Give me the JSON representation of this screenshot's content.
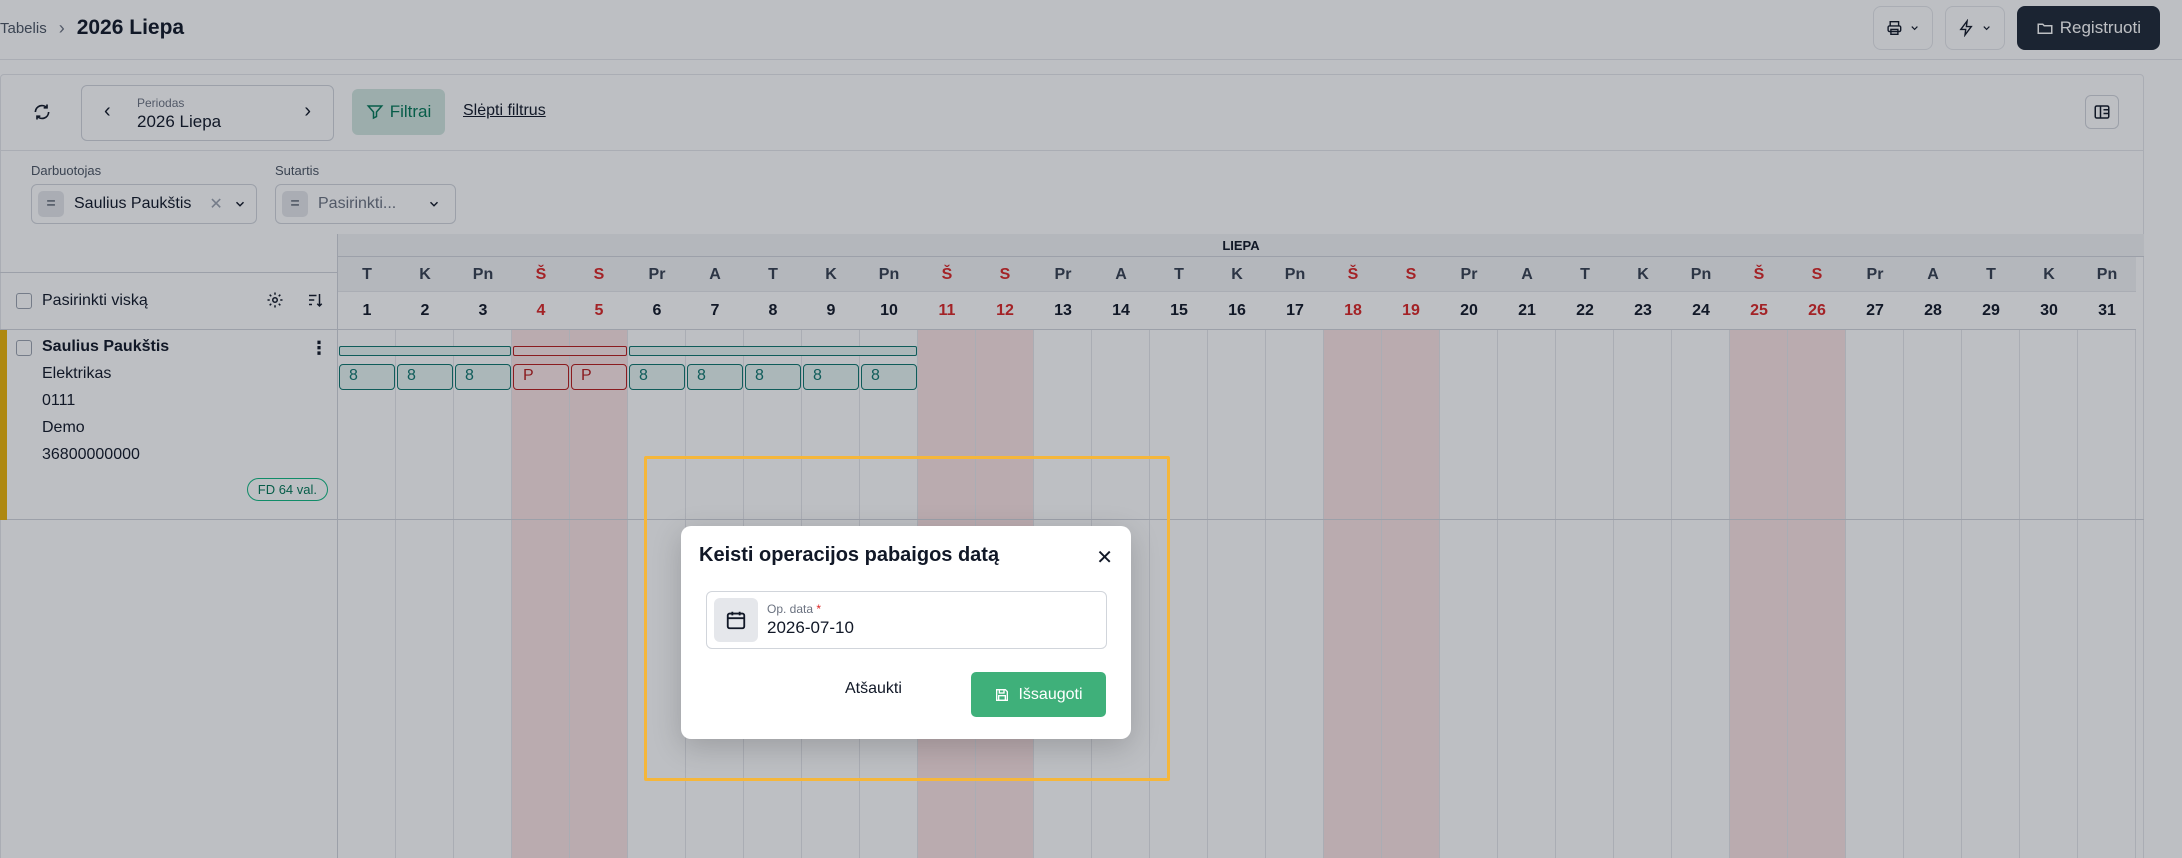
{
  "breadcrumb": {
    "parent": "Tabelis",
    "title": "2026 Liepa"
  },
  "top_actions": {
    "print_icon": "printer-icon",
    "quick_icon": "lightning-icon",
    "register_label": "Registruoti"
  },
  "toolbar": {
    "period_label": "Periodas",
    "period_value": "2026 Liepa",
    "filters_label": "Filtrai",
    "hide_filters_label": "Slėpti filtrus"
  },
  "filters": {
    "employee": {
      "label": "Darbuotojas",
      "operator": "=",
      "value": "Saulius Paukštis"
    },
    "contract": {
      "label": "Sutartis",
      "operator": "=",
      "placeholder": "Pasirinkti..."
    }
  },
  "grid": {
    "select_all_label": "Pasirinkti viską",
    "month_label": "LIEPA",
    "days": [
      {
        "dow": "T",
        "num": "1",
        "weekend": false
      },
      {
        "dow": "K",
        "num": "2",
        "weekend": false
      },
      {
        "dow": "Pn",
        "num": "3",
        "weekend": false
      },
      {
        "dow": "Š",
        "num": "4",
        "weekend": true
      },
      {
        "dow": "S",
        "num": "5",
        "weekend": true
      },
      {
        "dow": "Pr",
        "num": "6",
        "weekend": false
      },
      {
        "dow": "A",
        "num": "7",
        "weekend": false
      },
      {
        "dow": "T",
        "num": "8",
        "weekend": false
      },
      {
        "dow": "K",
        "num": "9",
        "weekend": false
      },
      {
        "dow": "Pn",
        "num": "10",
        "weekend": false
      },
      {
        "dow": "Š",
        "num": "11",
        "weekend": true
      },
      {
        "dow": "S",
        "num": "12",
        "weekend": true
      },
      {
        "dow": "Pr",
        "num": "13",
        "weekend": false
      },
      {
        "dow": "A",
        "num": "14",
        "weekend": false
      },
      {
        "dow": "T",
        "num": "15",
        "weekend": false
      },
      {
        "dow": "K",
        "num": "16",
        "weekend": false
      },
      {
        "dow": "Pn",
        "num": "17",
        "weekend": false
      },
      {
        "dow": "Š",
        "num": "18",
        "weekend": true
      },
      {
        "dow": "S",
        "num": "19",
        "weekend": true
      },
      {
        "dow": "Pr",
        "num": "20",
        "weekend": false
      },
      {
        "dow": "A",
        "num": "21",
        "weekend": false
      },
      {
        "dow": "T",
        "num": "22",
        "weekend": false
      },
      {
        "dow": "K",
        "num": "23",
        "weekend": false
      },
      {
        "dow": "Pn",
        "num": "24",
        "weekend": false
      },
      {
        "dow": "Š",
        "num": "25",
        "weekend": true
      },
      {
        "dow": "S",
        "num": "26",
        "weekend": true
      },
      {
        "dow": "Pr",
        "num": "27",
        "weekend": false
      },
      {
        "dow": "A",
        "num": "28",
        "weekend": false
      },
      {
        "dow": "T",
        "num": "29",
        "weekend": false
      },
      {
        "dow": "K",
        "num": "30",
        "weekend": false
      },
      {
        "dow": "Pn",
        "num": "31",
        "weekend": false
      }
    ]
  },
  "employee": {
    "name": "Saulius Paukštis",
    "position": "Elektrikas",
    "code": "0111",
    "department": "Demo",
    "personal_code": "36800000000",
    "fd_badge": "FD 64 val.",
    "cells": [
      "8",
      "8",
      "8",
      "P",
      "P",
      "8",
      "8",
      "8",
      "8",
      "8"
    ],
    "cell_types": [
      "work",
      "work",
      "work",
      "off",
      "off",
      "work",
      "work",
      "work",
      "work",
      "work"
    ]
  },
  "modal": {
    "title": "Keisti operacijos pabaigos datą",
    "field_label": "Op. data",
    "required_mark": "*",
    "field_value": "2026-07-10",
    "cancel_label": "Atšaukti",
    "save_label": "Išsaugoti"
  }
}
